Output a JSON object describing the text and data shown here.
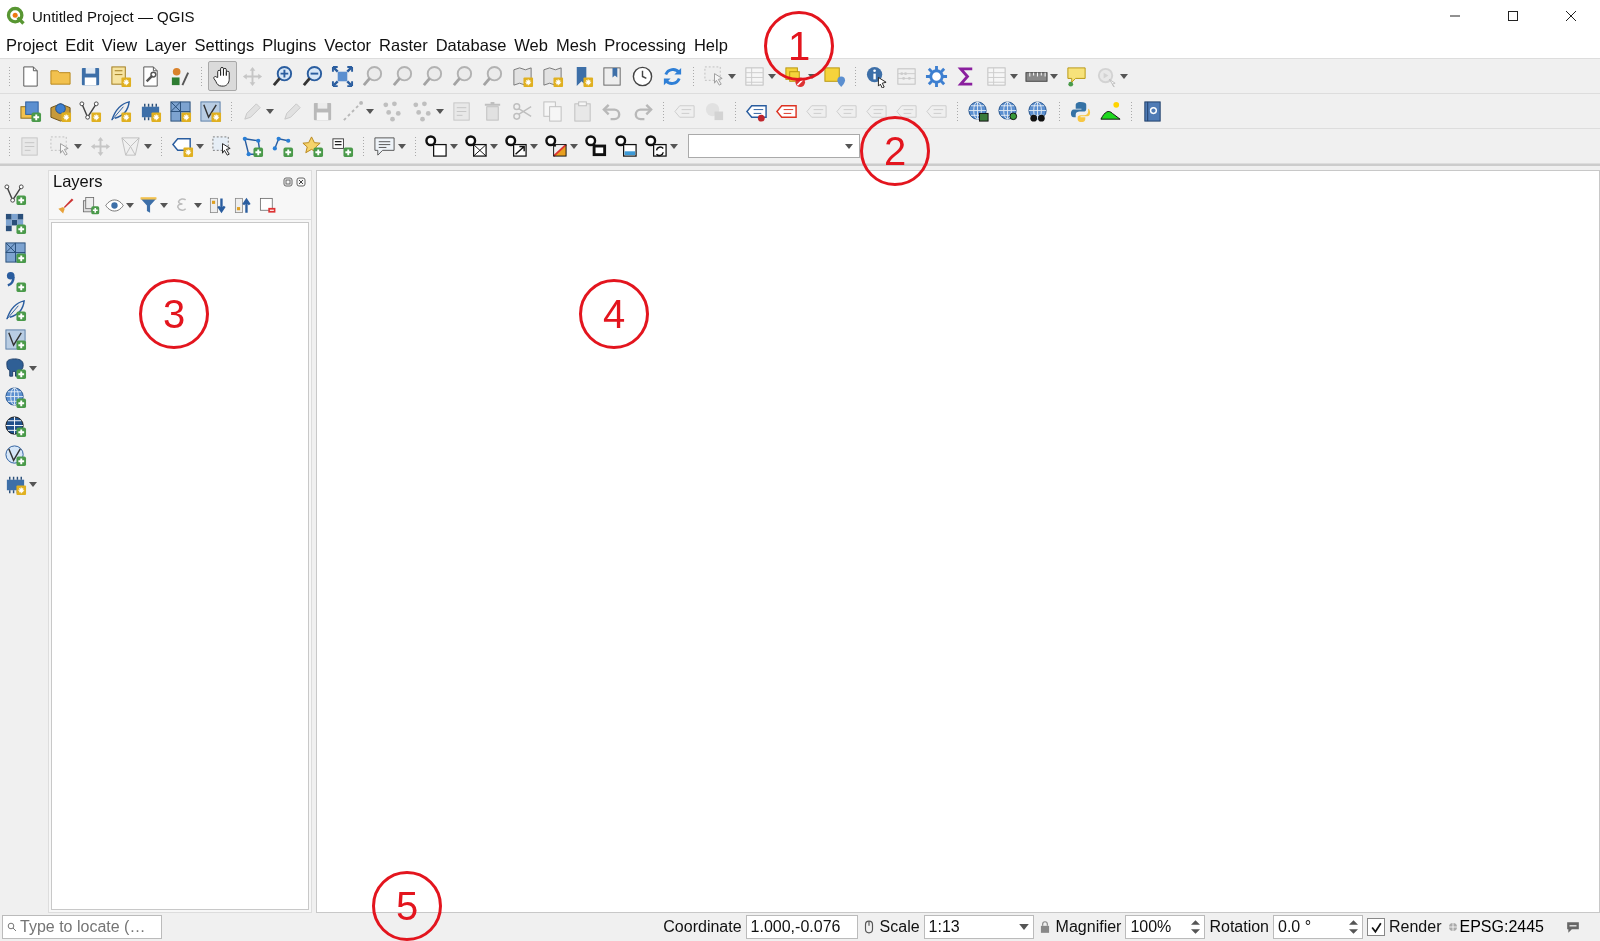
{
  "window": {
    "title": "Untitled Project — QGIS"
  },
  "menu": [
    "Project",
    "Edit",
    "View",
    "Layer",
    "Settings",
    "Plugins",
    "Vector",
    "Raster",
    "Database",
    "Web",
    "Mesh",
    "Processing",
    "Help"
  ],
  "toolbars": [
    {
      "groups": [
        [
          {
            "kind": "document",
            "disabled": false,
            "selected": false,
            "dropdown": false
          },
          {
            "kind": "folder",
            "disabled": false,
            "selected": false,
            "dropdown": false
          },
          {
            "kind": "disk",
            "disabled": false,
            "selected": false,
            "dropdown": false
          },
          {
            "kind": "sheet-star",
            "disabled": false,
            "selected": false,
            "dropdown": false
          },
          {
            "kind": "document-wrench",
            "disabled": false,
            "selected": false,
            "dropdown": false
          },
          {
            "kind": "shapes",
            "disabled": false,
            "selected": false,
            "dropdown": false
          }
        ],
        [
          {
            "kind": "hand",
            "disabled": false,
            "selected": true,
            "dropdown": false
          },
          {
            "kind": "move-arrows",
            "disabled": true,
            "selected": false,
            "dropdown": false
          },
          {
            "kind": "zoom-in",
            "disabled": false,
            "selected": false,
            "dropdown": false
          },
          {
            "kind": "zoom-out",
            "disabled": false,
            "selected": false,
            "dropdown": false
          },
          {
            "kind": "expand-arrows",
            "disabled": false,
            "selected": false,
            "dropdown": false
          },
          {
            "kind": "magnifier",
            "disabled": true,
            "selected": false,
            "dropdown": false
          },
          {
            "kind": "magnifier",
            "disabled": true,
            "selected": false,
            "dropdown": false
          },
          {
            "kind": "magnifier",
            "disabled": true,
            "selected": false,
            "dropdown": false
          },
          {
            "kind": "magnifier",
            "disabled": true,
            "selected": false,
            "dropdown": false
          },
          {
            "kind": "magnifier",
            "disabled": true,
            "selected": false,
            "dropdown": false
          },
          {
            "kind": "map-sheet",
            "disabled": false,
            "selected": false,
            "dropdown": false
          },
          {
            "kind": "map-sheet",
            "disabled": false,
            "selected": false,
            "dropdown": false
          },
          {
            "kind": "bookmark",
            "disabled": false,
            "selected": false,
            "dropdown": false
          },
          {
            "kind": "bookmark-sheet",
            "disabled": false,
            "selected": false,
            "dropdown": false
          },
          {
            "kind": "clock",
            "disabled": false,
            "selected": false,
            "dropdown": false
          },
          {
            "kind": "refresh",
            "disabled": false,
            "selected": false,
            "dropdown": false
          }
        ],
        [
          {
            "kind": "select-cursor",
            "disabled": true,
            "selected": false,
            "dropdown": true
          },
          {
            "kind": "table",
            "disabled": true,
            "selected": false,
            "dropdown": true
          },
          {
            "kind": "square-deny",
            "disabled": false,
            "selected": false,
            "dropdown": true
          },
          {
            "kind": "square-pin",
            "disabled": false,
            "selected": false,
            "dropdown": false
          }
        ],
        [
          {
            "kind": "info-cursor",
            "disabled": false,
            "selected": false,
            "dropdown": false
          },
          {
            "kind": "abacus",
            "disabled": true,
            "selected": false,
            "dropdown": false
          },
          {
            "kind": "gear",
            "disabled": false,
            "selected": false,
            "dropdown": false
          },
          {
            "kind": "sigma",
            "disabled": false,
            "selected": false,
            "dropdown": false
          },
          {
            "kind": "table",
            "disabled": true,
            "selected": false,
            "dropdown": true
          },
          {
            "kind": "ruler",
            "disabled": false,
            "selected": false,
            "dropdown": true
          },
          {
            "kind": "balloon",
            "disabled": false,
            "selected": false,
            "dropdown": false
          },
          {
            "kind": "gear-play",
            "disabled": true,
            "selected": false,
            "dropdown": true
          }
        ]
      ]
    },
    {
      "groups": [
        [
          {
            "kind": "layers",
            "disabled": false,
            "selected": false,
            "dropdown": false
          },
          {
            "kind": "globe-box",
            "disabled": false,
            "selected": false,
            "dropdown": false
          },
          {
            "kind": "vector",
            "disabled": false,
            "selected": false,
            "dropdown": false
          },
          {
            "kind": "feather",
            "disabled": false,
            "selected": false,
            "dropdown": false
          },
          {
            "kind": "chip",
            "disabled": false,
            "selected": false,
            "dropdown": false
          },
          {
            "kind": "grid",
            "disabled": false,
            "selected": false,
            "dropdown": false
          },
          {
            "kind": "vector-box",
            "disabled": false,
            "selected": false,
            "dropdown": false
          }
        ],
        [
          {
            "kind": "pencil",
            "disabled": true,
            "selected": false,
            "dropdown": true
          },
          {
            "kind": "pencil",
            "disabled": true,
            "selected": false,
            "dropdown": false
          },
          {
            "kind": "disk",
            "disabled": true,
            "selected": false,
            "dropdown": false
          },
          {
            "kind": "dashed-line",
            "disabled": true,
            "selected": false,
            "dropdown": true
          },
          {
            "kind": "nodes",
            "disabled": true,
            "selected": false,
            "dropdown": false
          },
          {
            "kind": "nodes",
            "disabled": true,
            "selected": false,
            "dropdown": true
          },
          {
            "kind": "sheet",
            "disabled": true,
            "selected": false,
            "dropdown": false
          },
          {
            "kind": "trash",
            "disabled": true,
            "selected": false,
            "dropdown": false
          },
          {
            "kind": "scissors",
            "disabled": true,
            "selected": false,
            "dropdown": false
          },
          {
            "kind": "copy",
            "disabled": true,
            "selected": false,
            "dropdown": false
          },
          {
            "kind": "clipboard",
            "disabled": true,
            "selected": false,
            "dropdown": false
          },
          {
            "kind": "undo",
            "disabled": true,
            "selected": false,
            "dropdown": false
          },
          {
            "kind": "redo",
            "disabled": true,
            "selected": false,
            "dropdown": false
          }
        ],
        [
          {
            "kind": "tag",
            "disabled": true,
            "selected": false,
            "dropdown": false
          },
          {
            "kind": "circle-square",
            "disabled": true,
            "selected": false,
            "dropdown": false
          }
        ],
        [
          {
            "kind": "tag-dot",
            "disabled": false,
            "selected": false,
            "dropdown": false
          },
          {
            "kind": "tag-outline",
            "disabled": false,
            "selected": false,
            "dropdown": false
          },
          {
            "kind": "tag",
            "disabled": true,
            "selected": false,
            "dropdown": false
          },
          {
            "kind": "tag",
            "disabled": true,
            "selected": false,
            "dropdown": false
          },
          {
            "kind": "tag",
            "disabled": true,
            "selected": false,
            "dropdown": false
          },
          {
            "kind": "tag",
            "disabled": true,
            "selected": false,
            "dropdown": false
          },
          {
            "kind": "tag",
            "disabled": true,
            "selected": false,
            "dropdown": false
          }
        ],
        [
          {
            "kind": "globe-table",
            "disabled": false,
            "selected": false,
            "dropdown": false
          },
          {
            "kind": "globe-search",
            "disabled": false,
            "selected": false,
            "dropdown": false
          },
          {
            "kind": "globe-binoculars",
            "disabled": false,
            "selected": false,
            "dropdown": false
          }
        ],
        [
          {
            "kind": "python",
            "disabled": false,
            "selected": false,
            "dropdown": false
          },
          {
            "kind": "hill",
            "disabled": false,
            "selected": false,
            "dropdown": false
          }
        ],
        [
          {
            "kind": "book",
            "disabled": false,
            "selected": false,
            "dropdown": false
          }
        ]
      ]
    },
    {
      "groups": [
        [
          {
            "kind": "sheet",
            "disabled": true,
            "selected": false,
            "dropdown": false
          },
          {
            "kind": "select-cursor",
            "disabled": true,
            "selected": false,
            "dropdown": true
          },
          {
            "kind": "move-arrows",
            "disabled": true,
            "selected": false,
            "dropdown": false
          },
          {
            "kind": "triangle-mesh",
            "disabled": true,
            "selected": false,
            "dropdown": true
          }
        ],
        [
          {
            "kind": "tag-star",
            "disabled": false,
            "selected": false,
            "dropdown": true
          },
          {
            "kind": "select-cursor",
            "disabled": false,
            "selected": false,
            "dropdown": false
          },
          {
            "kind": "polygon",
            "disabled": false,
            "selected": false,
            "dropdown": false
          },
          {
            "kind": "polyline",
            "disabled": false,
            "selected": false,
            "dropdown": false
          },
          {
            "kind": "star",
            "disabled": false,
            "selected": false,
            "dropdown": false
          },
          {
            "kind": "text-lines",
            "disabled": false,
            "selected": false,
            "dropdown": false
          }
        ],
        [
          {
            "kind": "text-balloon",
            "disabled": false,
            "selected": false,
            "dropdown": true
          }
        ],
        [
          {
            "kind": "pin-square",
            "disabled": false,
            "selected": false,
            "dropdown": true
          },
          {
            "kind": "pin-cross",
            "disabled": false,
            "selected": false,
            "dropdown": true
          },
          {
            "kind": "pin-arrow",
            "disabled": false,
            "selected": false,
            "dropdown": true
          },
          {
            "kind": "pin-triangle",
            "disabled": false,
            "selected": false,
            "dropdown": true
          },
          {
            "kind": "pin-film",
            "disabled": false,
            "selected": false,
            "dropdown": false
          },
          {
            "kind": "pin-tray",
            "disabled": false,
            "selected": false,
            "dropdown": false
          },
          {
            "kind": "pin-rotate",
            "disabled": false,
            "selected": false,
            "dropdown": true
          }
        ]
      ]
    }
  ],
  "left_toolbar": [
    {
      "kind": "vector-add",
      "disabled": false,
      "selected": false,
      "dropdown": false
    },
    {
      "kind": "checker-add",
      "disabled": false,
      "selected": false,
      "dropdown": false
    },
    {
      "kind": "grid-add",
      "disabled": false,
      "selected": false,
      "dropdown": false
    },
    {
      "kind": "comma-add",
      "disabled": false,
      "selected": false,
      "dropdown": false
    },
    {
      "kind": "feather-add",
      "disabled": false,
      "selected": false,
      "dropdown": false
    },
    {
      "kind": "vector-box-add",
      "disabled": false,
      "selected": false,
      "dropdown": false
    },
    {
      "kind": "elephant-add",
      "disabled": false,
      "selected": false,
      "dropdown": true
    },
    {
      "kind": "globe-add",
      "disabled": false,
      "selected": false,
      "dropdown": false
    },
    {
      "kind": "globe-dark-add",
      "disabled": false,
      "selected": false,
      "dropdown": false
    },
    {
      "kind": "globe-vector-add",
      "disabled": false,
      "selected": false,
      "dropdown": false
    },
    {
      "kind": "chip-star",
      "disabled": false,
      "selected": false,
      "dropdown": true
    }
  ],
  "layers_panel": {
    "title": "Layers",
    "tools": [
      {
        "kind": "brush",
        "disabled": false,
        "selected": false,
        "dropdown": false
      },
      {
        "kind": "pages-add",
        "disabled": false,
        "selected": false,
        "dropdown": false
      },
      {
        "kind": "eye",
        "disabled": false,
        "selected": false,
        "dropdown": true
      },
      {
        "kind": "funnel",
        "disabled": false,
        "selected": false,
        "dropdown": true
      },
      {
        "kind": "curve",
        "disabled": true,
        "selected": false,
        "dropdown": true
      },
      {
        "kind": "arrow-down",
        "disabled": false,
        "selected": false,
        "dropdown": false
      },
      {
        "kind": "arrow-up",
        "disabled": false,
        "selected": false,
        "dropdown": false
      },
      {
        "kind": "square-minus",
        "disabled": false,
        "selected": false,
        "dropdown": false
      }
    ]
  },
  "status_bar": {
    "locator": {
      "placeholder": "Type to locate (…"
    },
    "coordinate": {
      "label": "Coordinate",
      "value": "1.000,-0.076"
    },
    "scale": {
      "label": "Scale",
      "value": "1:13"
    },
    "magnifier": {
      "label": "Magnifier",
      "value": "100%"
    },
    "rotation": {
      "label": "Rotation",
      "value": "0.0 °"
    },
    "render": {
      "label": "Render",
      "checked": true
    },
    "crs": "EPSG:2445"
  },
  "annotations": [
    {
      "label": "1"
    },
    {
      "label": "2"
    },
    {
      "label": "3"
    },
    {
      "label": "4"
    },
    {
      "label": "5"
    }
  ]
}
